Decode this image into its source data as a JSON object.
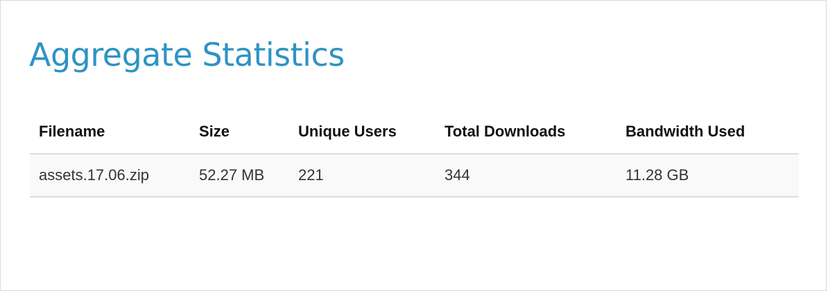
{
  "page": {
    "title": "Aggregate Statistics"
  },
  "table": {
    "headers": {
      "filename": "Filename",
      "size": "Size",
      "unique_users": "Unique Users",
      "total_downloads": "Total Downloads",
      "bandwidth_used": "Bandwidth Used"
    },
    "rows": [
      {
        "filename": "assets.17.06.zip",
        "size": "52.27 MB",
        "unique_users": "221",
        "total_downloads": "344",
        "bandwidth_used": "11.28 GB"
      }
    ]
  },
  "colors": {
    "title": "#2e93c4",
    "row_background": "#f9f9f9",
    "border": "#dddddd"
  }
}
